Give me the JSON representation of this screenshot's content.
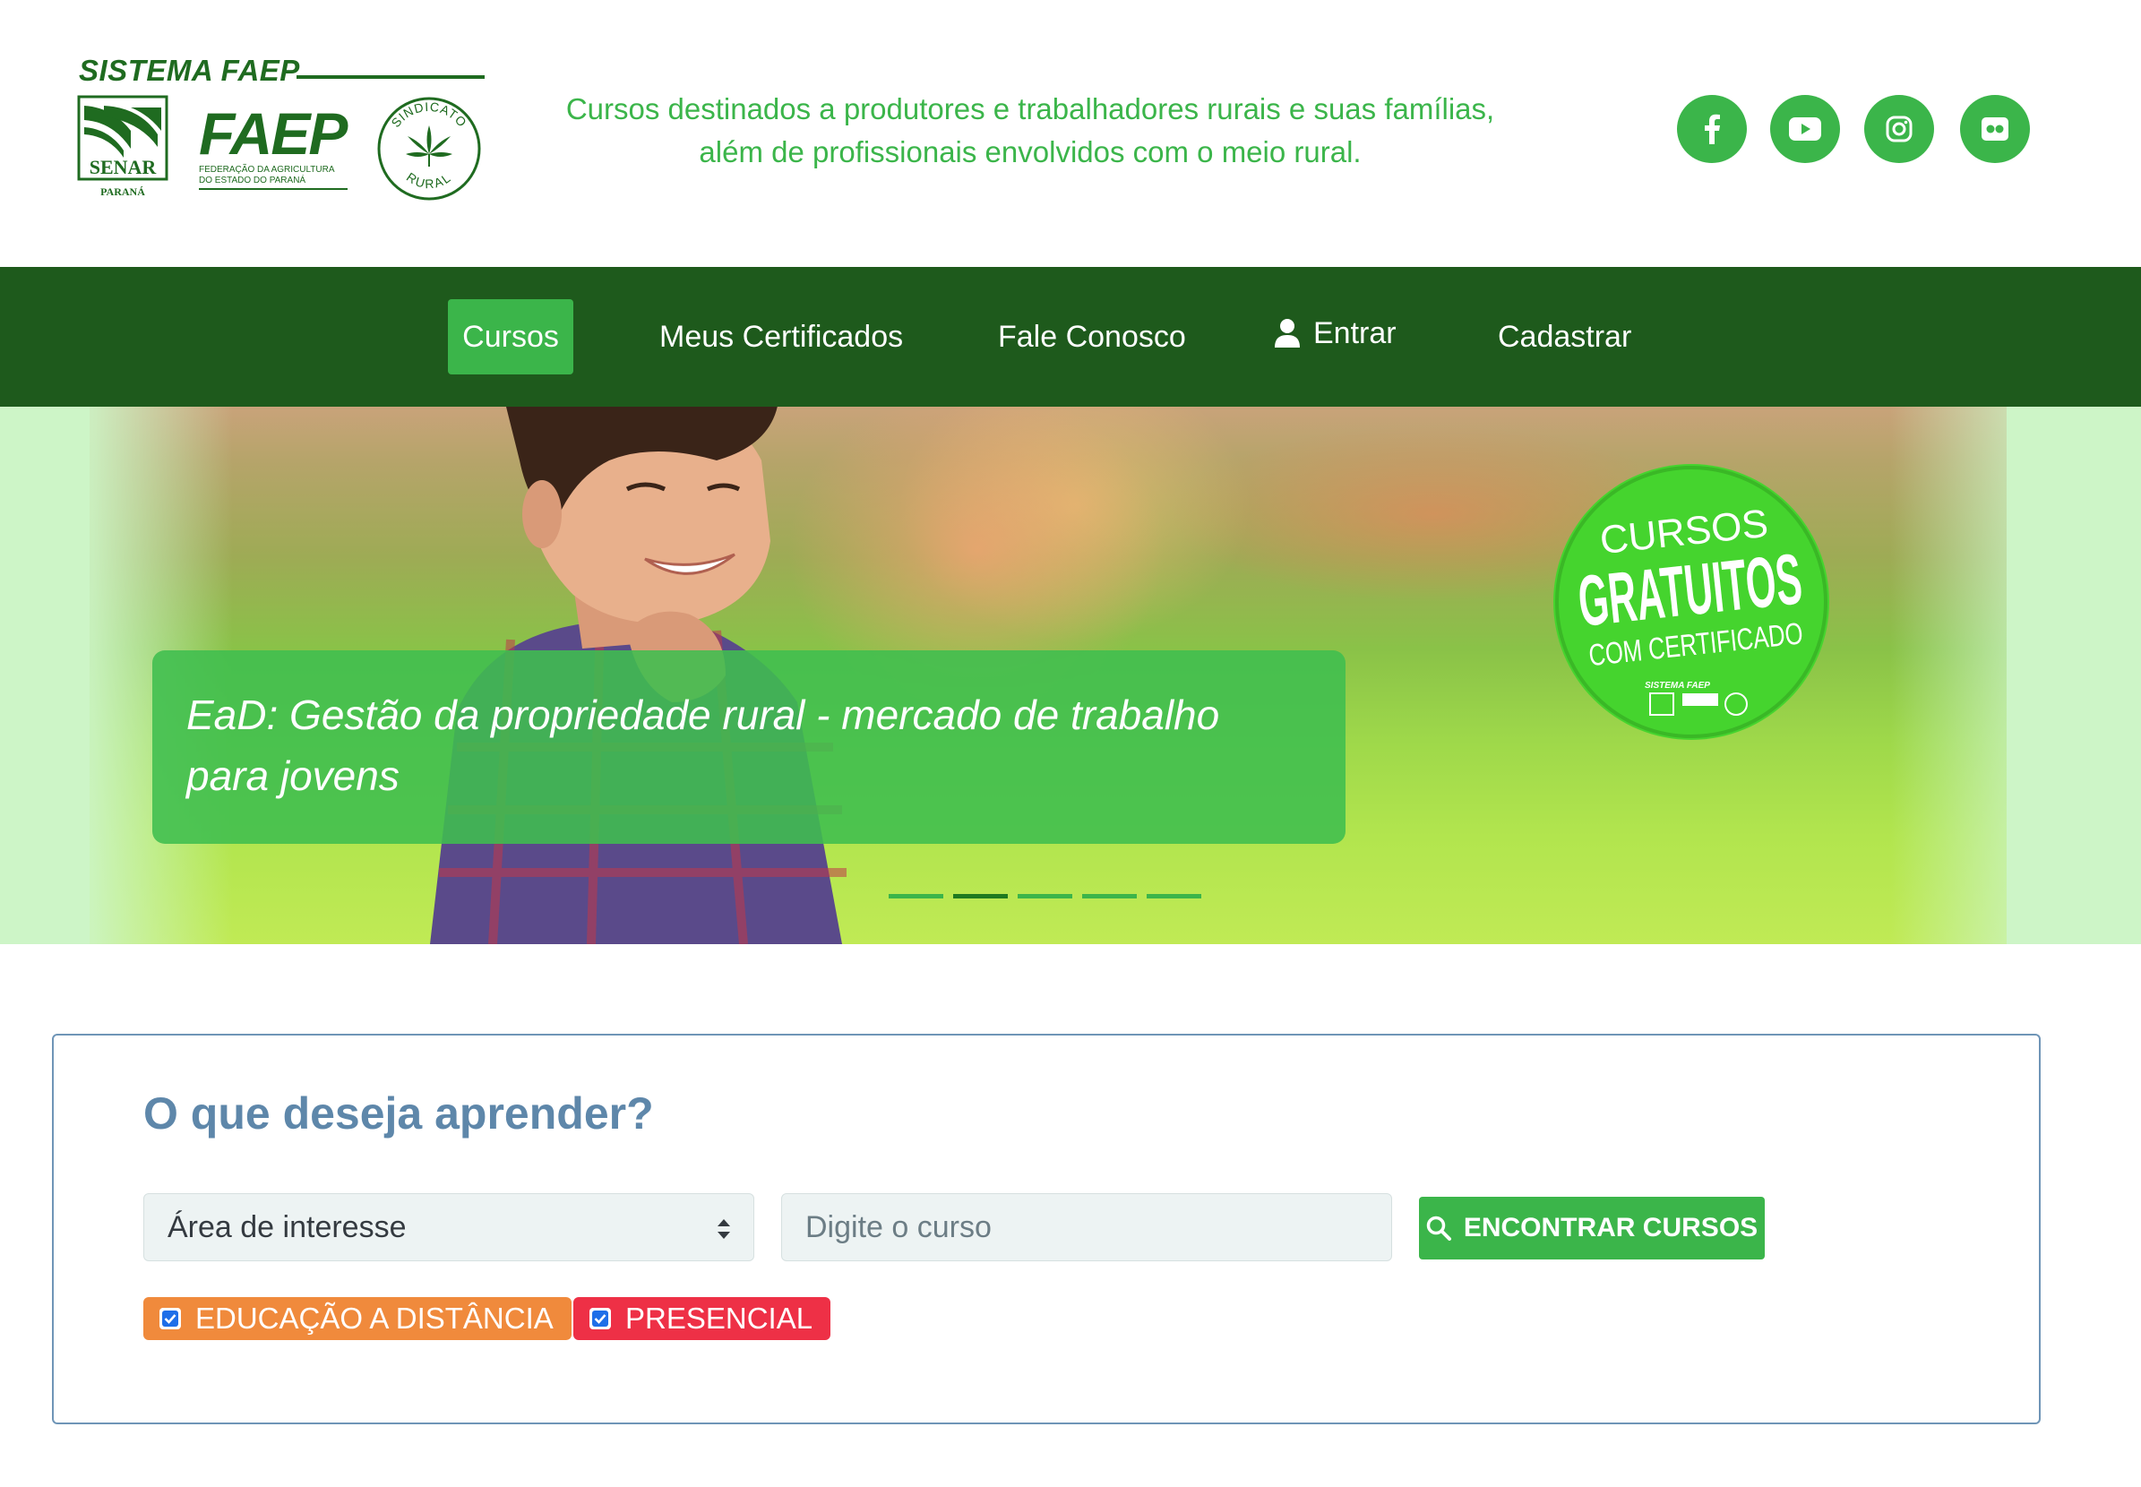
{
  "header": {
    "brand_title": "SISTEMA FAEP",
    "logos": {
      "senar_name": "SENAR",
      "senar_sub": "PARANÁ",
      "faep_name": "FAEP",
      "faep_sub1": "FEDERAÇÃO DA AGRICULTURA",
      "faep_sub2": "DO ESTADO DO PARANÁ",
      "sindicato_top": "SINDICATO",
      "sindicato_bottom": "RURAL"
    },
    "tagline_line1": "Cursos destinados a produtores e trabalhadores rurais e suas famílias,",
    "tagline_line2": "além de profissionais envolvidos com o meio rural.",
    "social": [
      {
        "name": "facebook-icon"
      },
      {
        "name": "youtube-icon"
      },
      {
        "name": "instagram-icon"
      },
      {
        "name": "flickr-icon"
      }
    ]
  },
  "nav": {
    "items": [
      {
        "label": "Cursos",
        "active": true
      },
      {
        "label": "Meus Certificados"
      },
      {
        "label": "Fale Conosco"
      },
      {
        "label": "Entrar",
        "icon": "user-icon"
      },
      {
        "label": "Cadastrar"
      }
    ]
  },
  "hero": {
    "caption": "EaD: Gestão da propriedade rural - mercado de trabalho para jovens",
    "badge_line1": "CURSOS",
    "badge_line2": "GRATUITOS",
    "badge_line3": "COM CERTIFICADO",
    "badge_brand": "SISTEMA FAEP",
    "slide_count": 5,
    "active_slide": 2
  },
  "search": {
    "title": "O que deseja aprender?",
    "area_select_value": "Área de interesse",
    "course_placeholder": "Digite o curso",
    "find_button": "ENCONTRAR CURSOS",
    "filters": [
      {
        "label": "EDUCAÇÃO A DISTÂNCIA",
        "checked": true,
        "color": "#f08a3c"
      },
      {
        "label": "PRESENCIAL",
        "checked": true,
        "color": "#ee3046"
      }
    ]
  },
  "colors": {
    "brand_green": "#3bb54a",
    "nav_green": "#1e5a1c",
    "logo_green": "#1f6b20",
    "title_blue": "#5e87aa"
  }
}
